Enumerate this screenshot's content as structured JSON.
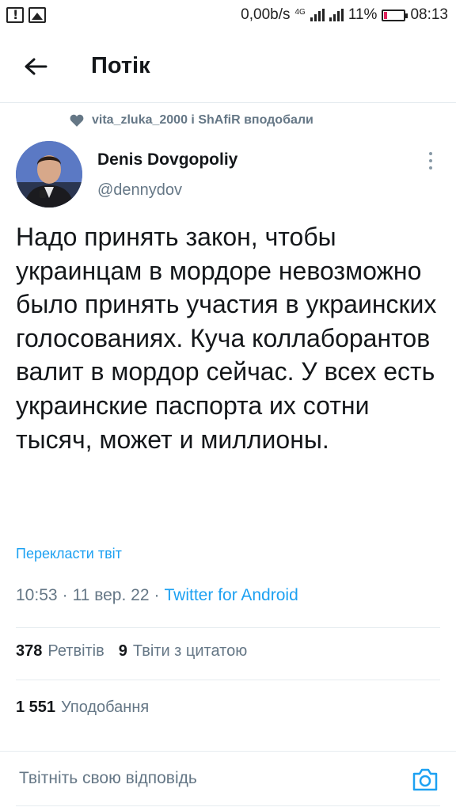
{
  "status_bar": {
    "network_speed": "0,00b/s",
    "network_type": "4G",
    "battery": "11%",
    "time": "08:13"
  },
  "header": {
    "title": "Потік"
  },
  "tweet": {
    "social_context": "vita_zluka_2000 і ShAfiR вподобали",
    "author_name": "Denis Dovgopoliy",
    "author_handle": "@dennydov",
    "text": "Надо принять закон, чтобы украинцам в мордоре невозможно было принять участия в украинских голосованиях. Куча коллаборантов валит в мордор сейчас. У всех есть украинские паспорта их сотни тысяч, может и миллионы.",
    "translate_label": "Перекласти твіт",
    "time": "10:53",
    "date": "11 вер. 22",
    "source": "Twitter for Android",
    "retweets_count": "378",
    "retweets_label": "Ретвітів",
    "quotes_count": "9",
    "quotes_label": "Твіти з цитатою",
    "likes_count": "1 551",
    "likes_label": "Уподобання"
  },
  "reply": {
    "placeholder": "Твітніть свою відповідь"
  },
  "icons": {
    "back": "arrow-left-icon",
    "heart": "heart-icon",
    "more": "more-vertical-icon",
    "camera": "camera-icon"
  },
  "colors": {
    "accent": "#1da1f2",
    "text_primary": "#14171a",
    "text_secondary": "#657786",
    "divider": "#e6ecf0",
    "battery_low": "#e0245e"
  }
}
